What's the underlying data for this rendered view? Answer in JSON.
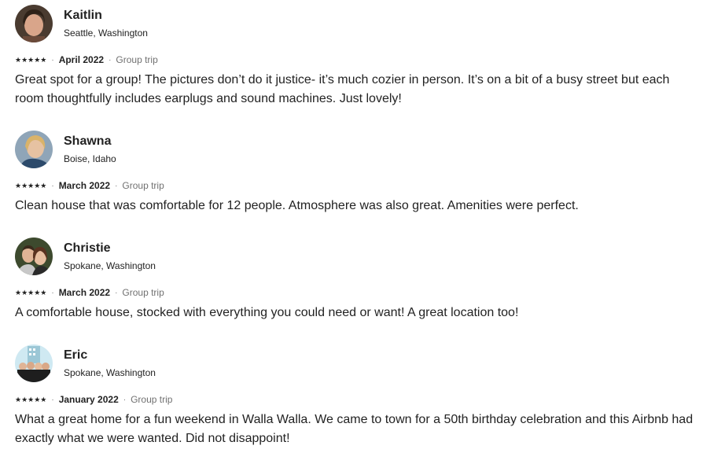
{
  "reviews": [
    {
      "name": "Kaitlin",
      "location": "Seattle, Washington",
      "rating": 5,
      "stars": "★★★★★",
      "date": "April 2022",
      "trip_type": "Group trip",
      "comment": "Great spot for a group! The pictures don’t do it justice- it’s much cozier in person. It’s on a bit of a busy street but each room thoughtfully includes earplugs and sound machines. Just lovely!"
    },
    {
      "name": "Shawna",
      "location": "Boise, Idaho",
      "rating": 5,
      "stars": "★★★★★",
      "date": "March 2022",
      "trip_type": "Group trip",
      "comment": "Clean house that was comfortable for 12 people. Atmosphere was also great. Amenities were perfect."
    },
    {
      "name": "Christie",
      "location": "Spokane, Washington",
      "rating": 5,
      "stars": "★★★★★",
      "date": "March 2022",
      "trip_type": "Group trip",
      "comment": "A comfortable house, stocked with everything you could need or want! A great location too!"
    },
    {
      "name": "Eric",
      "location": "Spokane, Washington",
      "rating": 5,
      "stars": "★★★★★",
      "date": "January 2022",
      "trip_type": "Group trip",
      "comment": "What a great home for a fun weekend in Walla Walla. We came to town for a 50th birthday celebration and this Airbnb had exactly what we were wanted. Did not disappoint!"
    }
  ],
  "separator": "·",
  "colors": {
    "text": "#222222",
    "muted": "#717171"
  }
}
